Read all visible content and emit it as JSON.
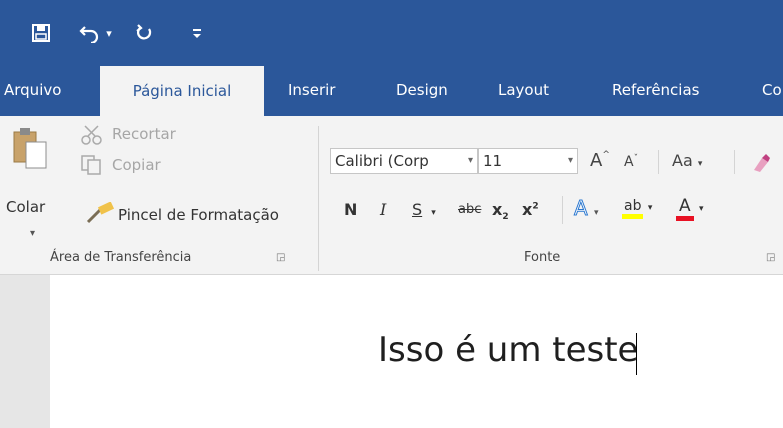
{
  "quick_access": {
    "save_icon": "save-icon",
    "undo_icon": "undo-icon",
    "undo_caret": "▾",
    "redo_icon": "repeat-icon",
    "customize_icon": "customize-qat-icon"
  },
  "tabs": [
    {
      "label": "Arquivo",
      "active": false
    },
    {
      "label": "Página Inicial",
      "active": true
    },
    {
      "label": "Inserir",
      "active": false
    },
    {
      "label": "Design",
      "active": false
    },
    {
      "label": "Layout",
      "active": false
    },
    {
      "label": "Referências",
      "active": false
    },
    {
      "label": "Co",
      "active": false
    }
  ],
  "clipboard": {
    "paste_label": "Colar",
    "paste_caret": "▾",
    "cut_label": "Recortar",
    "copy_label": "Copiar",
    "format_painter_label": "Pincel de Formatação",
    "group_label": "Área de Transferência"
  },
  "font": {
    "font_name": "Calibri (Corp",
    "font_size": "11",
    "grow_label": "A",
    "shrink_label": "A",
    "case_label": "Aa",
    "bold_label": "N",
    "italic_label": "I",
    "underline_label": "S",
    "strike_label": "abc",
    "subscript_label": "x",
    "subscript_mark": "2",
    "superscript_label": "x",
    "superscript_mark": "2",
    "effects_label": "A",
    "highlight_label": "ab",
    "color_label": "A",
    "group_label": "Fonte"
  },
  "document": {
    "text": "Isso é um teste"
  },
  "colors": {
    "brand": "#2b579a",
    "ribbon": "#f3f3f3",
    "highlight": "#ffff00",
    "font_color": "#ff0000"
  }
}
